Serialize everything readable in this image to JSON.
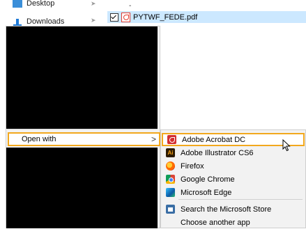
{
  "nav": {
    "items": [
      {
        "label": "Desktop",
        "icon": "desktop-icon"
      },
      {
        "label": "Downloads",
        "icon": "downloads-icon"
      }
    ]
  },
  "file": {
    "name": "PYTWF_FEDE.pdf",
    "top_dash": "-"
  },
  "context_menu": {
    "open_with_label": "Open with",
    "submenu_arrow": ">"
  },
  "submenu": {
    "items": [
      {
        "label": "Adobe Acrobat DC",
        "icon": "adobe-acrobat-icon"
      },
      {
        "label": "Adobe Illustrator CS6",
        "icon": "adobe-illustrator-icon",
        "icon_text": "Ai"
      },
      {
        "label": "Firefox",
        "icon": "firefox-icon"
      },
      {
        "label": "Google Chrome",
        "icon": "chrome-icon"
      },
      {
        "label": "Microsoft Edge",
        "icon": "edge-icon"
      },
      {
        "label": "Search the Microsoft Store",
        "icon": "store-icon"
      },
      {
        "label": "Choose another app",
        "icon": ""
      }
    ]
  },
  "colors": {
    "highlight_border": "#f2a81d",
    "selection": "#cce8ff"
  }
}
